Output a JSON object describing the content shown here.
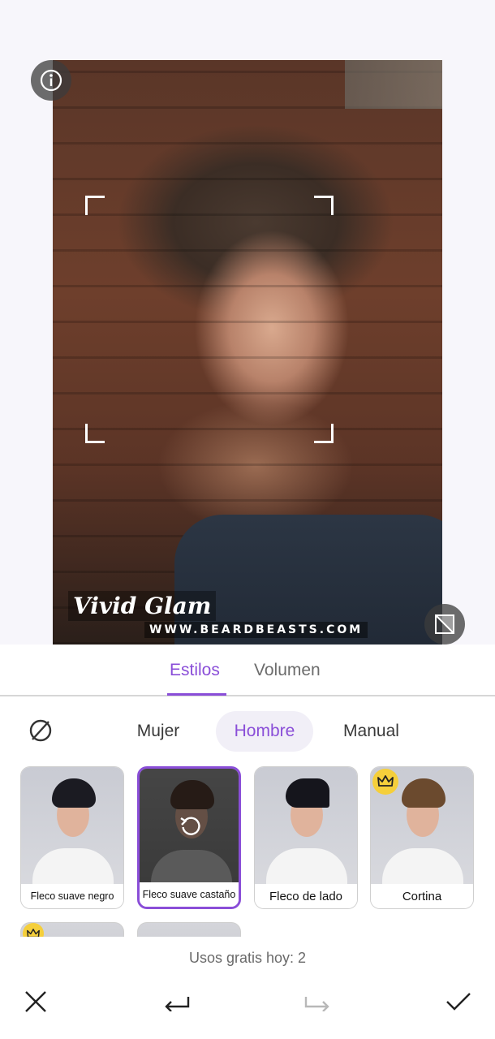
{
  "photo": {
    "watermark_title": "Vivid Glam",
    "watermark_url": "WWW.BEARDBEASTS.COM"
  },
  "tabs": [
    {
      "label": "Estilos",
      "active": true
    },
    {
      "label": "Volumen",
      "active": false
    }
  ],
  "categories": [
    {
      "label": "Mujer",
      "active": false
    },
    {
      "label": "Hombre",
      "active": true
    },
    {
      "label": "Manual",
      "active": false
    }
  ],
  "styles": [
    {
      "label": "Fleco suave negro",
      "selected": false,
      "premium": false,
      "hair_color": "#1b1b22"
    },
    {
      "label": "Fleco suave castaño",
      "selected": true,
      "premium": false,
      "hair_color": "#3b2a22"
    },
    {
      "label": "Fleco de lado",
      "selected": false,
      "premium": false,
      "hair_color": "#15151c"
    },
    {
      "label": "Cortina",
      "selected": false,
      "premium": true,
      "hair_color": "#6b4a2e"
    }
  ],
  "free_uses": "Usos gratis hoy: 2",
  "colors": {
    "accent": "#8a4ed8",
    "crown": "#f5cf3b"
  },
  "icons": {
    "info": "info-icon",
    "compare": "compare-icon",
    "none": "no-style-icon",
    "reset": "reset-icon",
    "crown": "crown-icon",
    "close": "close-icon",
    "undo": "undo-icon",
    "redo": "redo-icon",
    "apply": "check-icon"
  }
}
